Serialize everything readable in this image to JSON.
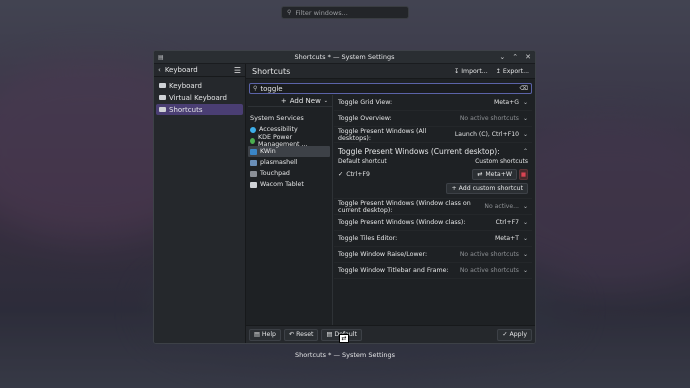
{
  "desktop": {
    "search_placeholder": "Filter windows...",
    "caption": "Shortcuts * — System Settings"
  },
  "window": {
    "title": "Shortcuts * — System Settings"
  },
  "sidebar": {
    "back_label": "Keyboard",
    "items": [
      {
        "label": "Keyboard"
      },
      {
        "label": "Virtual Keyboard"
      },
      {
        "label": "Shortcuts"
      }
    ]
  },
  "header": {
    "title": "Shortcuts",
    "import_label": "Import...",
    "export_label": "Export..."
  },
  "filter": {
    "value": "toggle"
  },
  "categories": {
    "add_new_label": "Add New",
    "section_label": "System Services",
    "items": [
      {
        "label": "Accessibility"
      },
      {
        "label": "KDE Power Management ..."
      },
      {
        "label": "KWin"
      },
      {
        "label": "plasmashell"
      },
      {
        "label": "Touchpad"
      },
      {
        "label": "Wacom Tablet"
      }
    ]
  },
  "shortcuts": {
    "rows_top": [
      {
        "name": "Toggle Grid View:",
        "value": "Meta+G"
      },
      {
        "name": "Toggle Overview:",
        "value": "No active shortcuts"
      },
      {
        "name": "Toggle Present Windows (All desktops):",
        "value": "Launch (C), Ctrl+F10"
      }
    ],
    "expanded": {
      "title": "Toggle Present Windows (Current desktop):",
      "default_label": "Default shortcut",
      "custom_label": "Custom shortcuts",
      "default_value": "Ctrl+F9",
      "custom_value": "Meta+W",
      "add_custom_label": "Add custom shortcut"
    },
    "rows_bottom": [
      {
        "name": "Toggle Present Windows (Window class on current desktop):",
        "value": "No active..."
      },
      {
        "name": "Toggle Present Windows (Window class):",
        "value": "Ctrl+F7"
      },
      {
        "name": "Toggle Tiles Editor:",
        "value": "Meta+T"
      },
      {
        "name": "Toggle Window Raise/Lower:",
        "value": "No active shortcuts"
      },
      {
        "name": "Toggle Window Titlebar and Frame:",
        "value": "No active shortcuts"
      }
    ]
  },
  "footer": {
    "help_label": "Help",
    "reset_label": "Reset",
    "defaults_label": "Default",
    "apply_label": "Apply"
  },
  "colors": {
    "accent": "#4a3e73",
    "filter_border": "#5b63a8",
    "delete_red": "#da4453"
  }
}
